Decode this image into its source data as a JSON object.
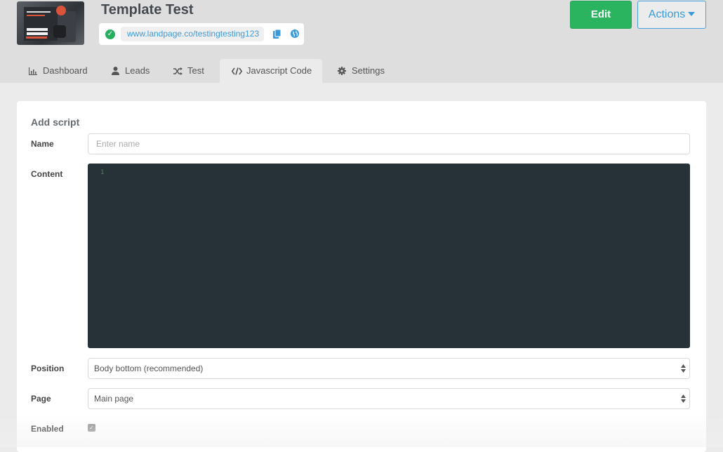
{
  "header": {
    "title": "Template Test",
    "url": "www.landpage.co/testingtesting123",
    "status_icon": "check-circle-icon",
    "copy_icon": "copy-icon",
    "globe_icon": "globe-icon",
    "edit_label": "Edit",
    "actions_label": "Actions"
  },
  "tabs": [
    {
      "label": "Dashboard",
      "icon": "bar-chart-icon",
      "active": false
    },
    {
      "label": "Leads",
      "icon": "user-icon",
      "active": false
    },
    {
      "label": "Test",
      "icon": "shuffle-icon",
      "active": false
    },
    {
      "label": "Javascript Code",
      "icon": "code-icon",
      "active": true
    },
    {
      "label": "Settings",
      "icon": "gear-icon",
      "active": false
    }
  ],
  "form": {
    "section_title": "Add script",
    "name_label": "Name",
    "name_placeholder": "Enter name",
    "name_value": "",
    "content_label": "Content",
    "editor_line_number": "1",
    "position_label": "Position",
    "position_value": "Body bottom (recommended)",
    "page_label": "Page",
    "page_value": "Main page",
    "enabled_label": "Enabled",
    "enabled_checked": true
  },
  "colors": {
    "primary_green": "#2ab45f",
    "link_blue": "#3a9ad9",
    "editor_bg": "#263238"
  }
}
